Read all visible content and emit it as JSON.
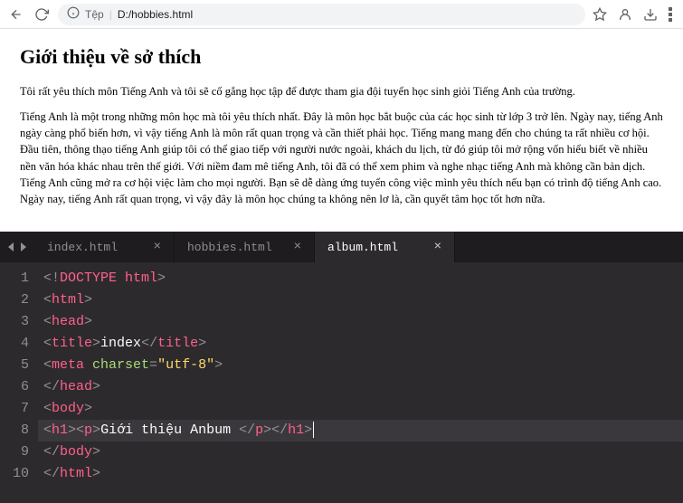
{
  "browser": {
    "url_label": "Tệp",
    "url_path": "D:/hobbies.html"
  },
  "page": {
    "heading": "Giới thiệu về sở thích",
    "para1": "Tôi rất yêu thích môn Tiếng Anh và tôi sẽ cố gắng học tập để được tham gia đội tuyển học sinh giỏi Tiếng Anh của trường.",
    "para2": "Tiếng Anh là một trong những môn học mà tôi yêu thích nhất. Đây là môn học bắt buộc của các học sinh từ lớp 3 trở lên. Ngày nay, tiếng Anh ngày càng phổ biến hơn, vì vậy tiếng Anh là môn rất quan trọng và cần thiết phải học. Tiếng mang mang đến cho chúng ta rất nhiều cơ hội. Đầu tiên, thông thạo tiếng Anh giúp tôi có thể giao tiếp với người nước ngoài, khách du lịch, từ đó giúp tôi mở rộng vốn hiểu biết về nhiều nền văn hóa khác nhau trên thế giới. Với niềm đam mê tiếng Anh, tôi đã có thể xem phim và nghe nhạc tiếng Anh mà không cần bản dịch. Tiếng Anh cũng mở ra cơ hội việc làm cho mọi người. Bạn sẽ dễ dàng ứng tuyển công việc mình yêu thích nếu bạn có trình độ tiếng Anh cao. Ngày nay, tiếng Anh rất quan trọng, vì vậy đây là môn học chúng ta không nên lơ là, cần quyết tâm học tốt hơn nữa."
  },
  "editor": {
    "tabs": [
      {
        "label": "index.html",
        "active": false
      },
      {
        "label": "hobbies.html",
        "active": false
      },
      {
        "label": "album.html",
        "active": true
      }
    ],
    "code": {
      "l1": {
        "a": "<!",
        "b": "DOCTYPE ",
        "c": "html",
        "d": ">"
      },
      "l2": {
        "a": "<",
        "b": "html",
        "c": ">"
      },
      "l3": {
        "a": "<",
        "b": "head",
        "c": ">"
      },
      "l4": {
        "a": "<",
        "b": "title",
        "c": ">",
        "d": "index",
        "e": "</",
        "f": "title",
        "g": ">"
      },
      "l5": {
        "a": "<",
        "b": "meta ",
        "c": "charset",
        "d": "=",
        "e": "\"utf-8\"",
        "f": ">"
      },
      "l6": {
        "a": "</",
        "b": "head",
        "c": ">"
      },
      "l7": {
        "a": "<",
        "b": "body",
        "c": ">"
      },
      "l8": {
        "a": "<",
        "b": "h1",
        "c": "><",
        "d": "p",
        "e": ">",
        "f": "Giới thiệu Anbum ",
        "g": "</",
        "h": "p",
        "i": "></",
        "j": "h1",
        "k": ">"
      },
      "l9": {
        "a": "</",
        "b": "body",
        "c": ">"
      },
      "l10": {
        "a": "</",
        "b": "html",
        "c": ">"
      }
    }
  }
}
